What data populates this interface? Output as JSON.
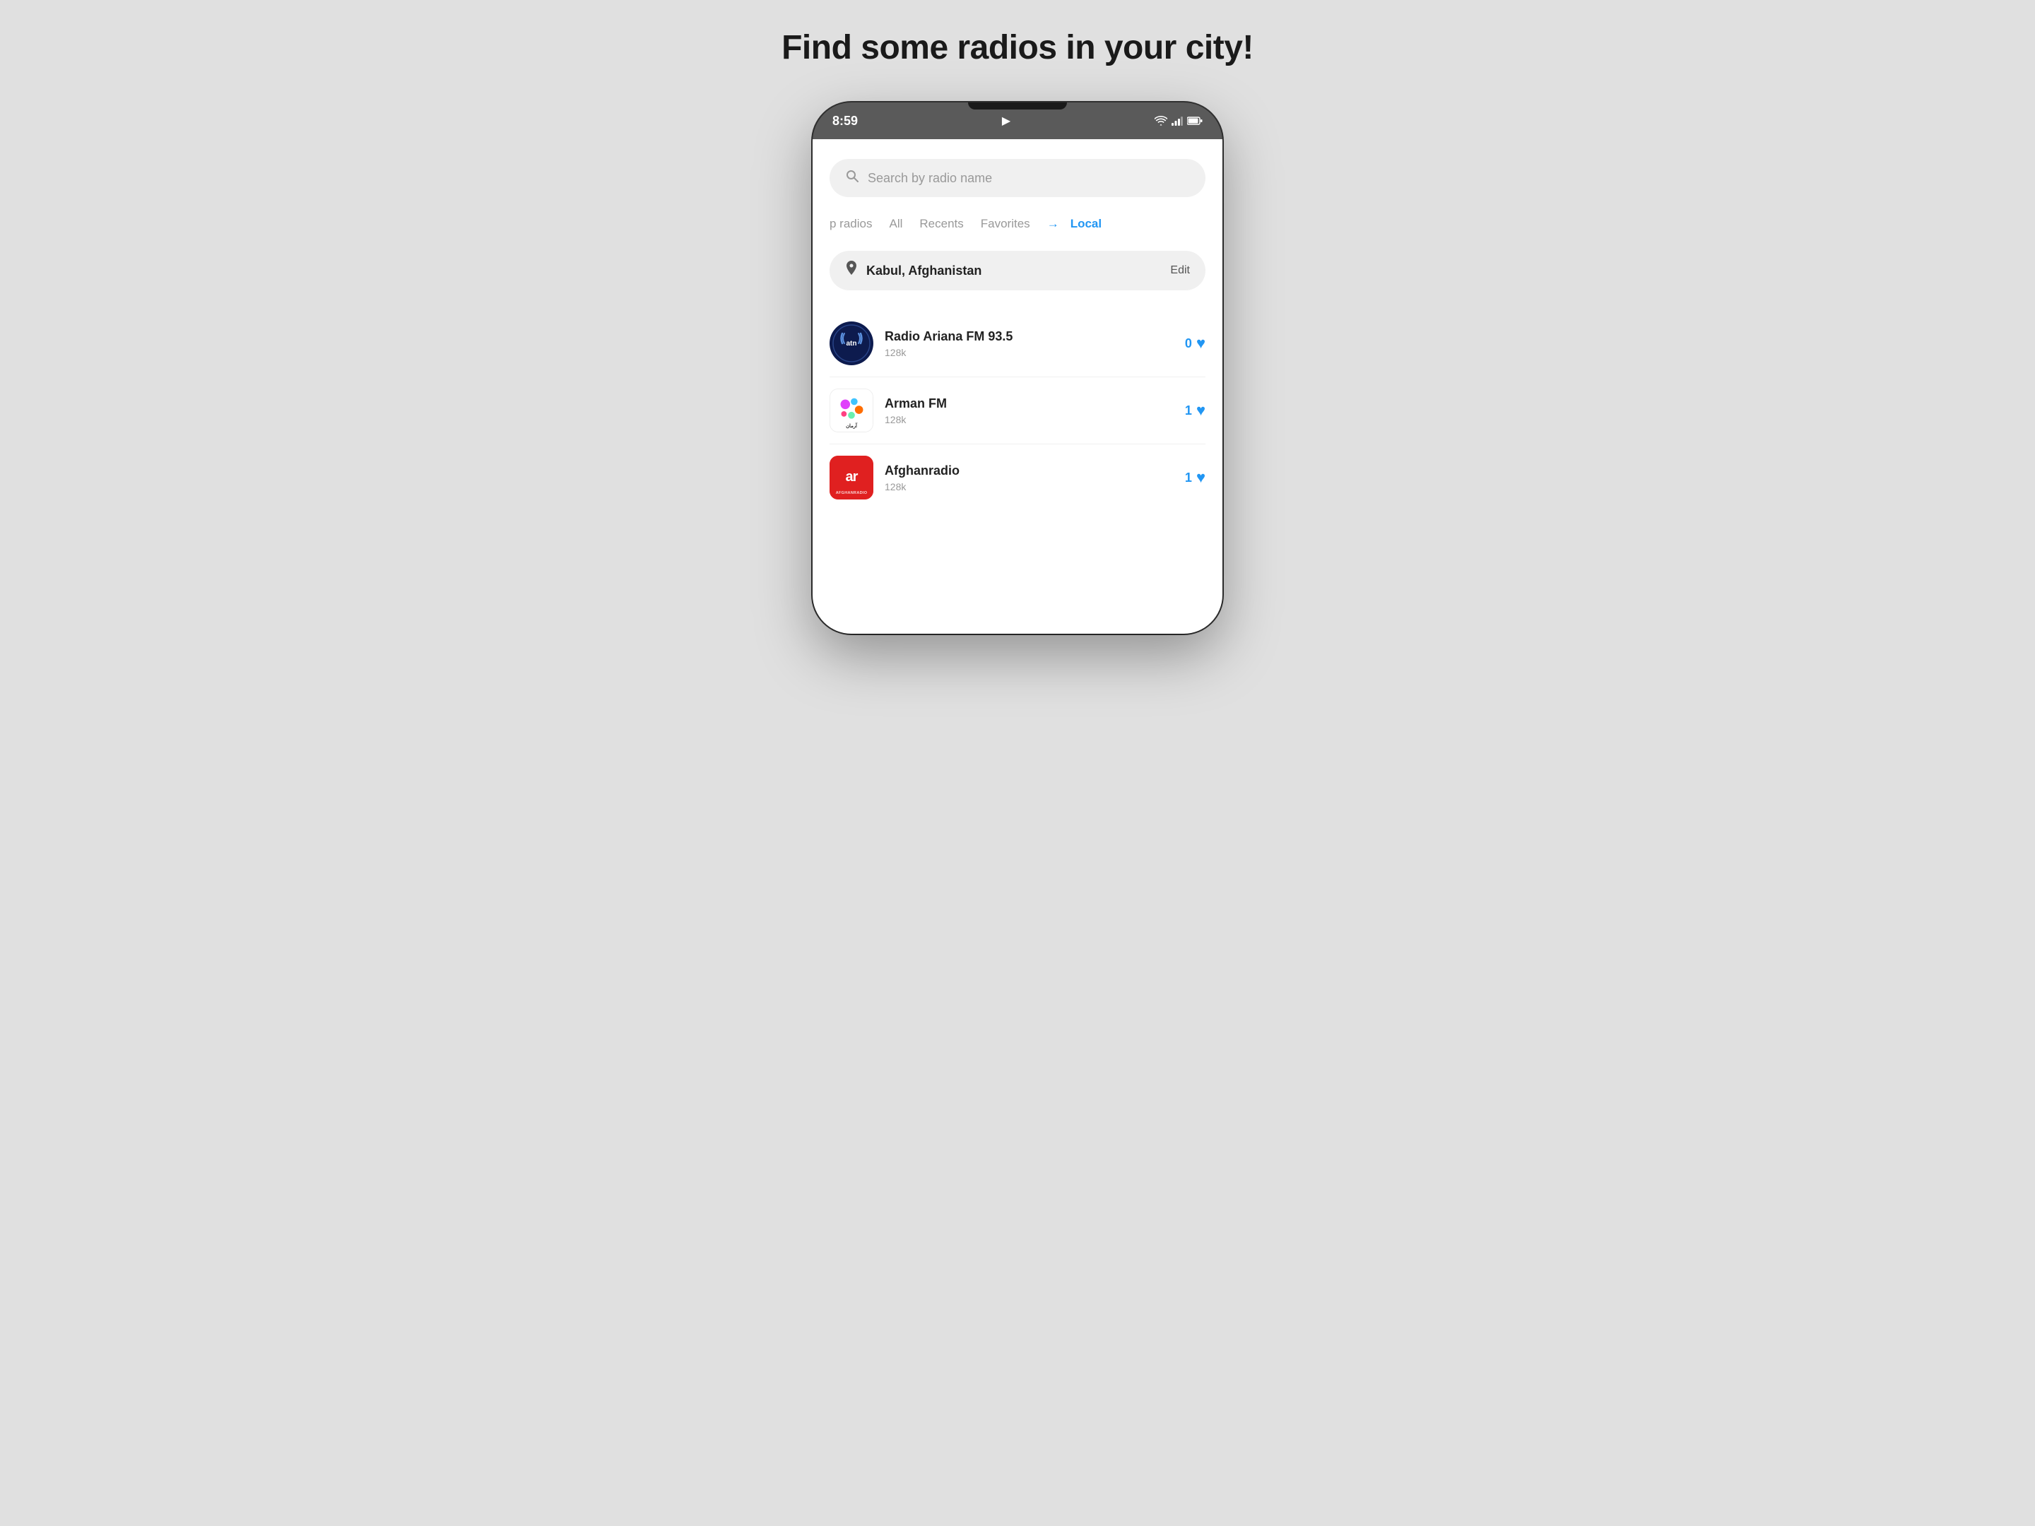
{
  "page": {
    "title": "Find some radios in your city!",
    "background_color": "#e0e0e0"
  },
  "status_bar": {
    "time": "8:59",
    "play_icon": "▶",
    "wifi": "wifi",
    "signal": "signal",
    "battery": "battery"
  },
  "search": {
    "placeholder": "Search by radio name"
  },
  "tabs": [
    {
      "label": "p radios",
      "active": false
    },
    {
      "label": "All",
      "active": false
    },
    {
      "label": "Recents",
      "active": false
    },
    {
      "label": "Favorites",
      "active": false
    },
    {
      "label": "Local",
      "active": true
    }
  ],
  "location": {
    "name": "Kabul, Afghanistan",
    "edit_label": "Edit"
  },
  "radios": [
    {
      "name": "Radio Ariana FM 93.5",
      "quality": "128k",
      "likes": "0",
      "logo_type": "atr",
      "logo_text": "atn"
    },
    {
      "name": "Arman FM",
      "quality": "128k",
      "likes": "1",
      "logo_type": "arman",
      "logo_text": "Arman"
    },
    {
      "name": "Afghanradio",
      "quality": "128k",
      "likes": "1",
      "logo_type": "afghan",
      "logo_text": "ar"
    }
  ]
}
